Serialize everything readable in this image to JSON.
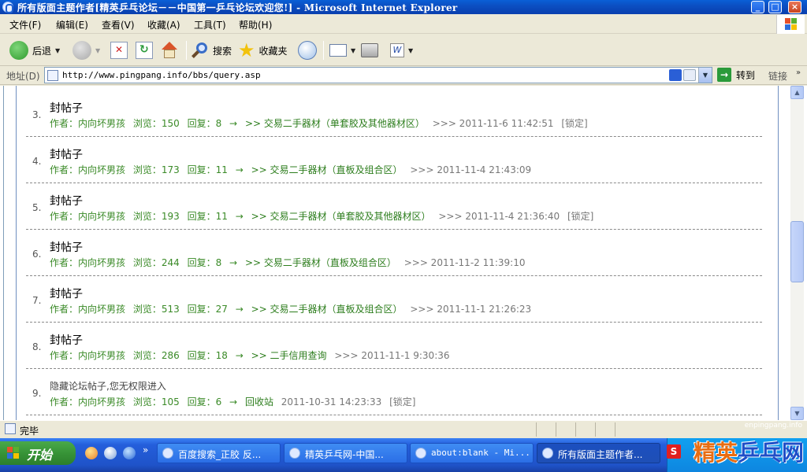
{
  "window": {
    "title": "所有版面主题作者[精英乒乓论坛－－中国第一乒乓论坛欢迎您!] - Microsoft Internet Explorer",
    "controls": {
      "minimize": "_",
      "maximize": "□",
      "close": "×"
    }
  },
  "menubar": {
    "items": [
      "文件(F)",
      "编辑(E)",
      "查看(V)",
      "收藏(A)",
      "工具(T)",
      "帮助(H)"
    ]
  },
  "toolbar": {
    "back": "后退",
    "search": "搜索",
    "favorites": "收藏夹"
  },
  "address": {
    "label": "地址(D)",
    "url": "http://www.pingpang.info/bbs/query.asp",
    "go": "转到",
    "links": "链接"
  },
  "posts": [
    {
      "num": "3.",
      "title": "封帖子",
      "author": "作者：内向坏男孩",
      "views": "浏览：150",
      "replies": "回复：8",
      "board": ">> 交易二手器材（单套胶及其他器材区）",
      "time": ">>> 2011-11-6 11:42:51",
      "lock": "[锁定]"
    },
    {
      "num": "4.",
      "title": "封帖子",
      "author": "作者：内向坏男孩",
      "views": "浏览：173",
      "replies": "回复：11",
      "board": ">> 交易二手器材（直板及组合区）",
      "time": ">>> 2011-11-4 21:43:09",
      "lock": ""
    },
    {
      "num": "5.",
      "title": "封帖子",
      "author": "作者：内向坏男孩",
      "views": "浏览：193",
      "replies": "回复：11",
      "board": ">> 交易二手器材（单套胶及其他器材区）",
      "time": ">>> 2011-11-4 21:36:40",
      "lock": "[锁定]"
    },
    {
      "num": "6.",
      "title": "封帖子",
      "author": "作者：内向坏男孩",
      "views": "浏览：244",
      "replies": "回复：8",
      "board": ">> 交易二手器材（直板及组合区）",
      "time": ">>> 2011-11-2 11:39:10",
      "lock": ""
    },
    {
      "num": "7.",
      "title": "封帖子",
      "author": "作者：内向坏男孩",
      "views": "浏览：513",
      "replies": "回复：27",
      "board": ">> 交易二手器材（直板及组合区）",
      "time": ">>> 2011-11-1 21:26:23",
      "lock": ""
    },
    {
      "num": "8.",
      "title": "封帖子",
      "author": "作者：内向坏男孩",
      "views": "浏览：286",
      "replies": "回复：18",
      "board": ">> 二手信用查询",
      "time": ">>> 2011-11-1 9:30:36",
      "lock": ""
    },
    {
      "num": "9.",
      "title": "隐藏论坛帖子,您无权限进入",
      "author": "作者：内向坏男孩",
      "views": "浏览：105",
      "replies": "回复：6",
      "board": "回收站",
      "time": "2011-10-31 14:23:33",
      "lock": "[锁定]"
    }
  ],
  "arrow": "→",
  "status": {
    "text": "完毕"
  },
  "taskbar": {
    "start": "开始",
    "tasks": [
      "百度搜索_正胶 反...",
      "精英乒乓网-中国...",
      "about:blank - Mi...",
      "所有版面主题作者..."
    ]
  },
  "watermark": {
    "text_a": "精英",
    "text_b": "乒乓网",
    "url": "enpingpang.info"
  },
  "ime": {
    "label": "S"
  }
}
